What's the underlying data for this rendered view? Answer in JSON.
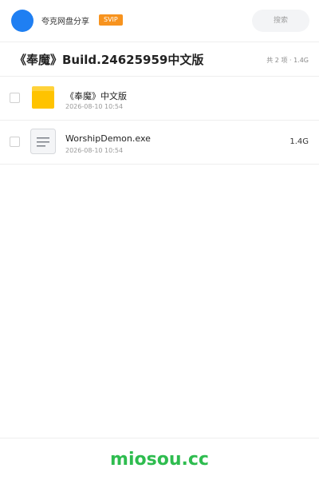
{
  "header": {
    "brand": "夸克网盘分享",
    "badge": "SVIP",
    "search_placeholder": "搜索",
    "avatar_color": "#1f7ff2",
    "badge_color": "#f7931e"
  },
  "share": {
    "title": "《奉魔》Build.24625959中文版",
    "summary": "共 2 项 · 1.4G"
  },
  "files": [
    {
      "icon": "folder-icon",
      "name": "《奉魔》中文版",
      "date": "2026-08-10 10:54",
      "size": ""
    },
    {
      "icon": "file-icon",
      "name": "WorshipDemon.exe",
      "date": "2026-08-10 10:54",
      "size": "1.4G"
    }
  ],
  "footer": {
    "brand": "miosou.cc",
    "brand_color": "#2ebc4f"
  }
}
